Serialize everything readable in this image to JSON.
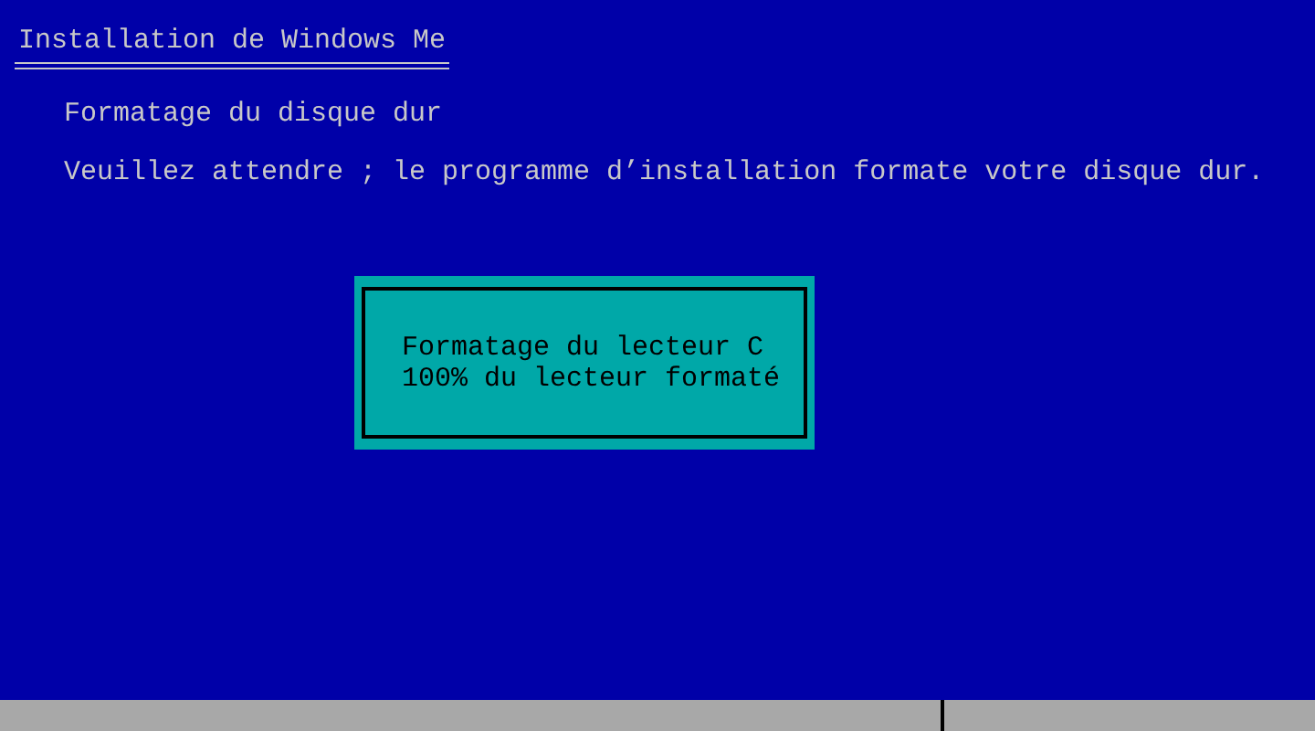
{
  "window": {
    "title": "Installation de Windows Me"
  },
  "heading": "Formatage du disque dur",
  "message": "Veuillez attendre ; le programme d’installation formate votre disque dur.",
  "dialog": {
    "lines": [
      "Formatage du lecteur C",
      "100% du lecteur formaté"
    ]
  }
}
